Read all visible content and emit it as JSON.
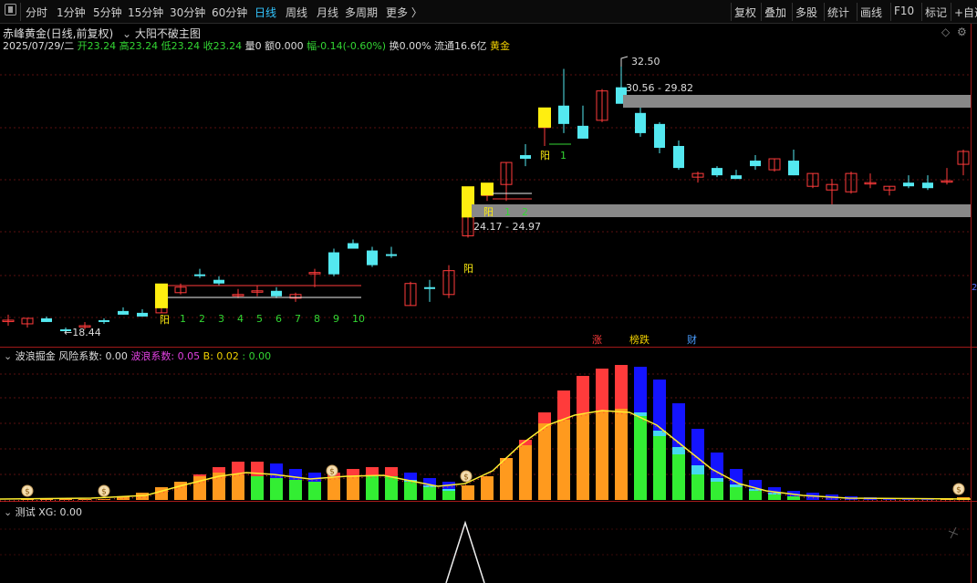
{
  "toolbar": {
    "left": [
      {
        "label": "分时",
        "active": false
      },
      {
        "label": "1分钟",
        "active": false
      },
      {
        "label": "5分钟",
        "active": false
      },
      {
        "label": "15分钟",
        "active": false
      },
      {
        "label": "30分钟",
        "active": false
      },
      {
        "label": "60分钟",
        "active": false
      },
      {
        "label": "日线",
        "active": true
      },
      {
        "label": "周线",
        "active": false
      },
      {
        "label": "月线",
        "active": false
      },
      {
        "label": "多周期",
        "active": false
      },
      {
        "label": "更多 〉",
        "active": false
      }
    ],
    "right": [
      {
        "label": "复权"
      },
      {
        "label": "叠加"
      },
      {
        "label": "多股"
      },
      {
        "label": "统计"
      },
      {
        "label": "画线"
      },
      {
        "label": "F10"
      },
      {
        "label": "标记"
      },
      {
        "label": "+自选"
      }
    ]
  },
  "main_chart": {
    "title": "赤峰黄金(日线,前复权)",
    "indicator": "大阳不破主图",
    "quote": {
      "date": "2025/07/29/二",
      "open_label": "开",
      "open": "23.24",
      "high_label": "高",
      "high": "23.24",
      "low_label": "低",
      "low": "23.24",
      "close_label": "收",
      "close": "23.24",
      "vol_label": "量",
      "vol": "0",
      "amt_label": "额",
      "amt": "0.000",
      "chg_label": "幅",
      "chg": "-0.14(-0.60%)",
      "turnover_label": "换",
      "turnover": "0.00%",
      "float_label": "流通",
      "float": "16.6亿",
      "sector": "黄金"
    },
    "annotations": {
      "high_price": "32.50",
      "low_price": "←18.44",
      "range_upper": "30.56 - 29.82",
      "range_lower": "24.17 - 24.97",
      "yang": "阳",
      "count1": [
        "1",
        "2",
        "3",
        "4",
        "5",
        "6",
        "7",
        "8",
        "9",
        "10"
      ],
      "count2": [
        "1",
        "2"
      ],
      "count3": [
        "1"
      ],
      "events": [
        {
          "label": "涨",
          "color": "#ff3b3b"
        },
        {
          "label": "榜跌",
          "color": "#f0d000"
        },
        {
          "label": "财",
          "color": "#4a9dff"
        }
      ],
      "right_edge": "2"
    }
  },
  "wave_panel": {
    "name": "波浪掘金",
    "risk_label": "风险系数:",
    "risk_value": "0.00",
    "wave_label": "波浪系数:",
    "wave_value": "0.05",
    "b_label": "B:",
    "b_value": "0.02",
    "extra": ": 0.00"
  },
  "test_panel": {
    "name": "测试",
    "xg_label": "XG:",
    "xg_value": "0.00"
  }
}
